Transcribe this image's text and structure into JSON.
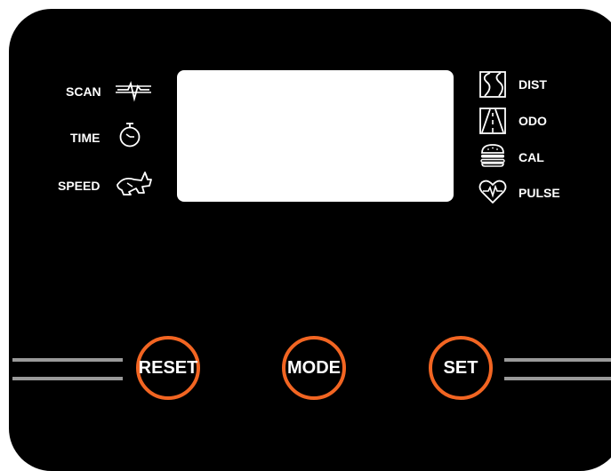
{
  "left_indicators": [
    {
      "label": "SCAN",
      "icon": "scan-pulse-icon"
    },
    {
      "label": "TIME",
      "icon": "stopwatch-icon"
    },
    {
      "label": "SPEED",
      "icon": "rabbit-icon"
    }
  ],
  "right_indicators": [
    {
      "label": "DIST",
      "icon": "road-curve-icon"
    },
    {
      "label": "ODO",
      "icon": "road-perspective-icon"
    },
    {
      "label": "CAL",
      "icon": "burger-icon"
    },
    {
      "label": "PULSE",
      "icon": "heart-pulse-icon"
    }
  ],
  "buttons": {
    "reset": "RESET",
    "mode": "MODE",
    "set": "SET"
  },
  "colors": {
    "panel": "#000000",
    "button_ring": "#f26522",
    "rail": "#9a9a9a",
    "lcd": "#ffffff"
  }
}
